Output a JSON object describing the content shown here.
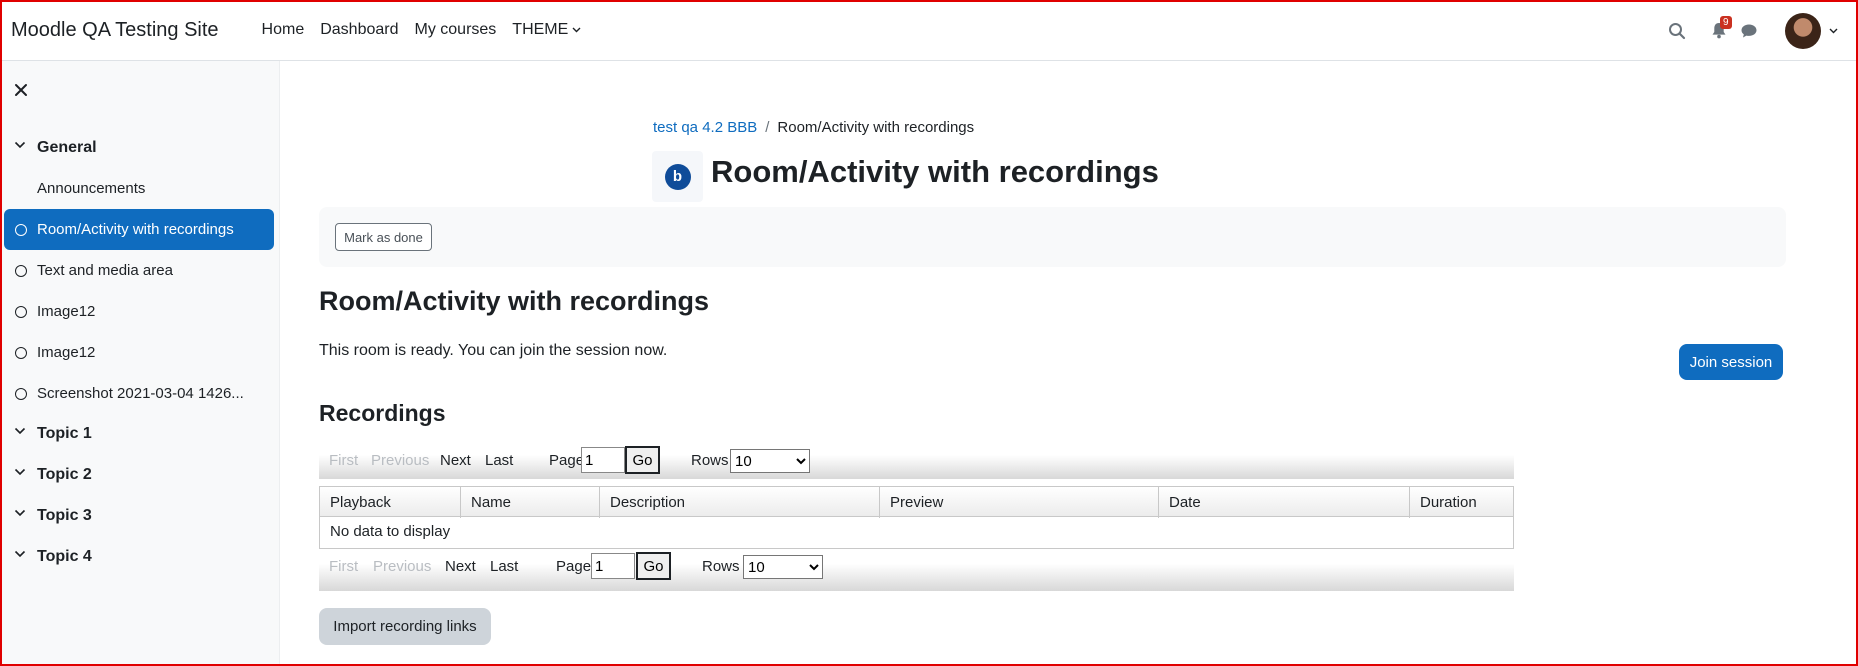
{
  "navbar": {
    "brand": "Moodle QA Testing Site",
    "links": [
      "Home",
      "Dashboard",
      "My courses",
      "THEME"
    ],
    "notification_count": "9"
  },
  "sidebar": {
    "items": [
      {
        "type": "section",
        "label": "General"
      },
      {
        "type": "plain",
        "label": "Announcements"
      },
      {
        "type": "activity",
        "label": "Room/Activity with recordings",
        "active": true
      },
      {
        "type": "activity",
        "label": "Text and media area"
      },
      {
        "type": "activity",
        "label": "Image12"
      },
      {
        "type": "activity",
        "label": "Image12"
      },
      {
        "type": "activity",
        "label": "Screenshot 2021-03-04 1426..."
      },
      {
        "type": "section",
        "label": "Topic 1"
      },
      {
        "type": "section",
        "label": "Topic 2"
      },
      {
        "type": "section",
        "label": "Topic 3"
      },
      {
        "type": "section",
        "label": "Topic 4"
      }
    ]
  },
  "breadcrumb": {
    "course": "test qa 4.2 BBB",
    "current": "Room/Activity with recordings"
  },
  "activity_icon_letter": "b",
  "page": {
    "title": "Room/Activity with recordings",
    "mark_done": "Mark as done",
    "heading": "Room/Activity with recordings",
    "ready_text": "This room is ready. You can join the session now.",
    "join_button": "Join session",
    "recordings_heading": "Recordings",
    "import_button": "Import recording links"
  },
  "pager": {
    "first": "First",
    "previous": "Previous",
    "next": "Next",
    "last": "Last",
    "page_label": "Page",
    "page_value": "1",
    "go": "Go",
    "rows_label": "Rows",
    "rows_value": "10"
  },
  "table": {
    "columns": [
      "Playback",
      "Name",
      "Description",
      "Preview",
      "Date",
      "Duration"
    ],
    "empty_text": "No data to display"
  },
  "colors": {
    "primary": "#0f6cbf",
    "frame": "#e00000",
    "badge": "#ca3120"
  }
}
